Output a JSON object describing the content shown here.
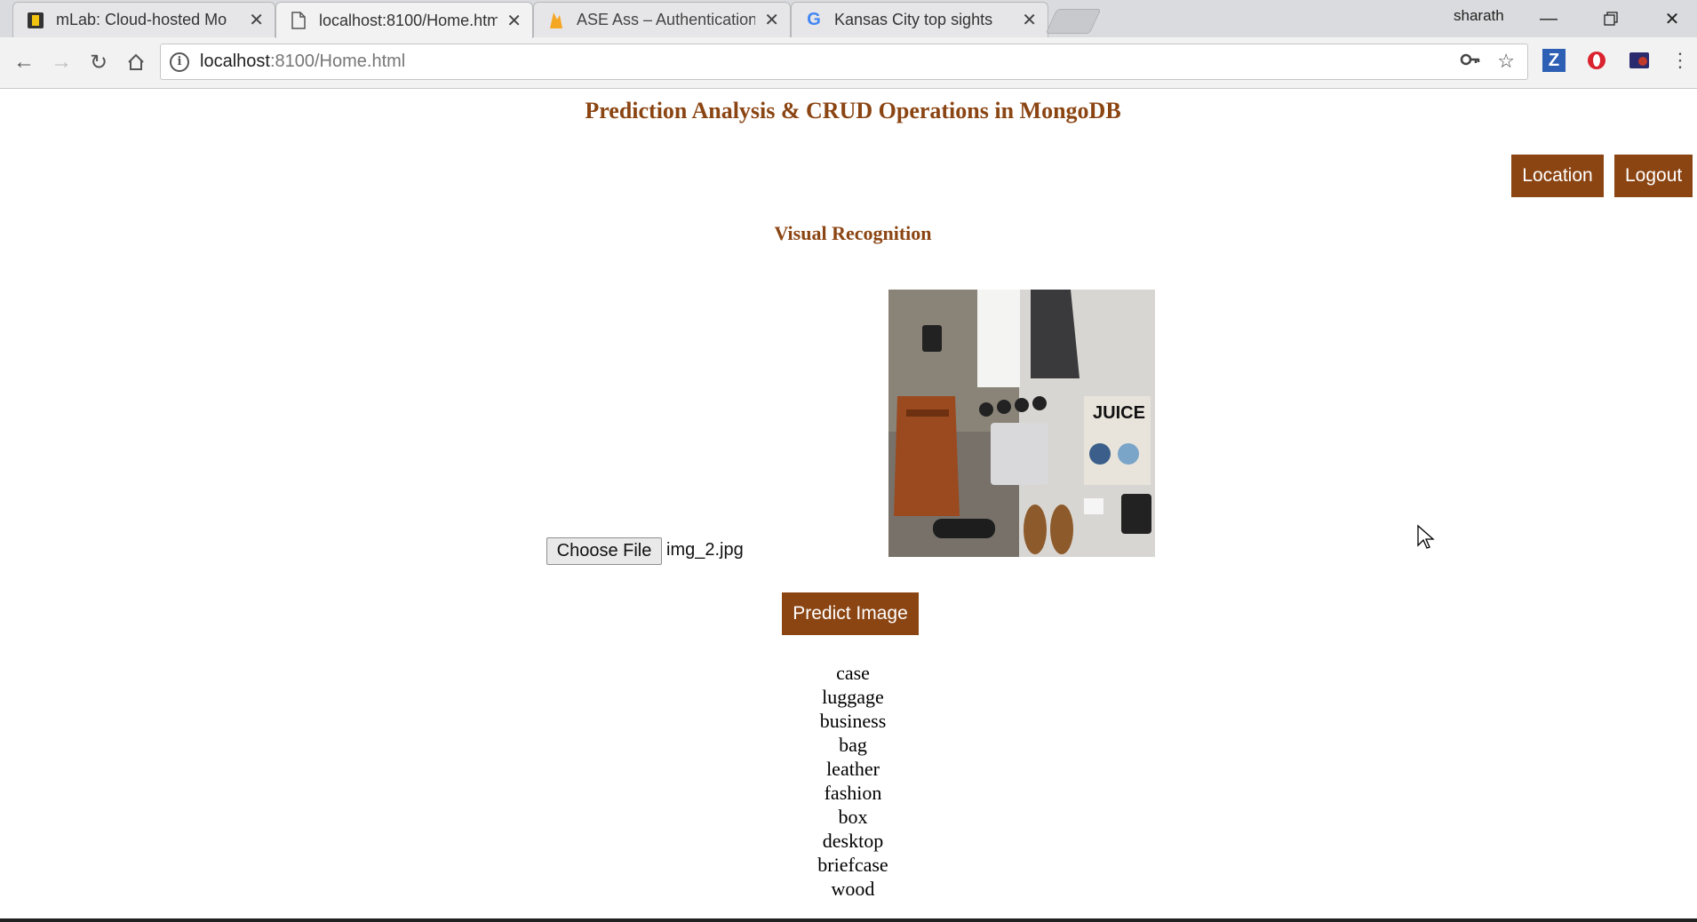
{
  "browser": {
    "tabs": [
      {
        "title": "mLab: Cloud-hosted Mo",
        "icon": "mlab-icon"
      },
      {
        "title": "localhost:8100/Home.htm",
        "icon": "page-icon"
      },
      {
        "title": "ASE Ass – Authentication",
        "icon": "firebase-icon"
      },
      {
        "title": "Kansas City top sights",
        "icon": "google-icon"
      }
    ],
    "profile_name": "sharath",
    "url_host": "localhost",
    "url_path": ":8100/Home.html"
  },
  "page": {
    "title": "Prediction Analysis & CRUD Operations in MongoDB",
    "location_button": "Location",
    "logout_button": "Logout",
    "section_title": "Visual Recognition",
    "choose_file_label": "Choose File",
    "file_name": "img_2.jpg",
    "predict_button": "Predict Image",
    "results": [
      "case",
      "luggage",
      "business",
      "bag",
      "leather",
      "fashion",
      "box",
      "desktop",
      "briefcase",
      "wood"
    ]
  },
  "colors": {
    "accent": "#8b4513"
  }
}
